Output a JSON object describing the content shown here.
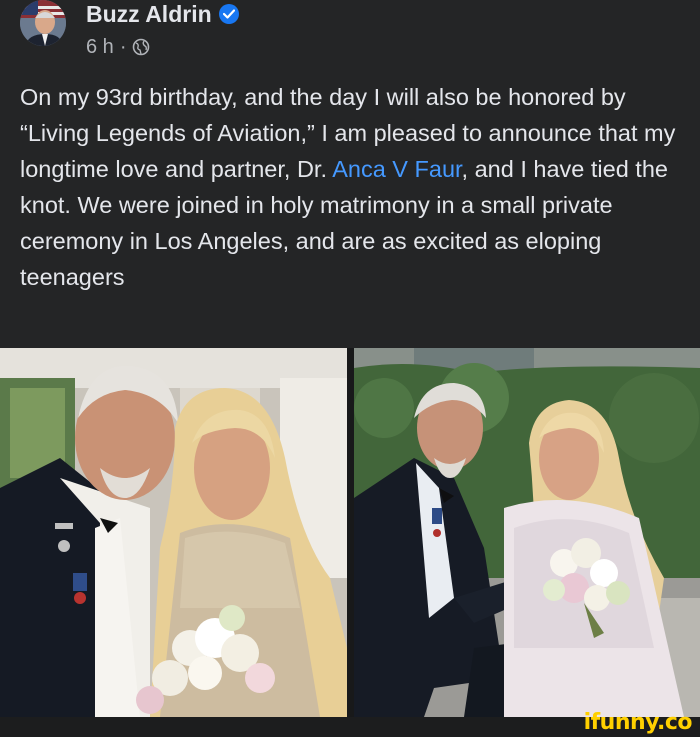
{
  "post": {
    "author_name": "Buzz Aldrin",
    "time": "6 h",
    "separator": "·",
    "body_before_link": "On my 93rd birthday, and the day I will also be honored by “Living Legends of Aviation,” I am pleased to announce that my longtime love and partner, Dr. ",
    "link_text": "Anca V Faur",
    "body_after_link": ", and I have tied the knot. We were joined in holy matrimony in a small private ceremony in Los Angeles, and are as excited as eloping teenagers"
  },
  "icons": {
    "verified": "verified-badge-icon",
    "audience": "globe-icon"
  },
  "colors": {
    "background": "#242526",
    "text": "#e4e6eb",
    "secondary_text": "#b0b3b8",
    "link": "#4599ff",
    "verified_badge": "#1877f2",
    "watermark": "#ffd000"
  },
  "watermark": {
    "text": "ifunny.co"
  }
}
